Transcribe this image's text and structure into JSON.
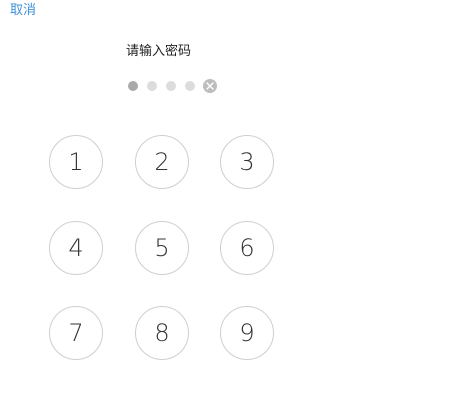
{
  "header": {
    "cancel_label": "取消"
  },
  "prompt": "请输入密码",
  "passcode": {
    "filled": 1,
    "total": 4,
    "clear_icon": "clear-icon"
  },
  "keypad": {
    "keys": [
      "1",
      "2",
      "3",
      "4",
      "5",
      "6",
      "7",
      "8",
      "9"
    ]
  },
  "colors": {
    "accent": "#3d8fd9",
    "key_border": "#cfcfcf",
    "dot_filled": "#a9a9a9",
    "dot_empty": "#dcdcdc"
  }
}
